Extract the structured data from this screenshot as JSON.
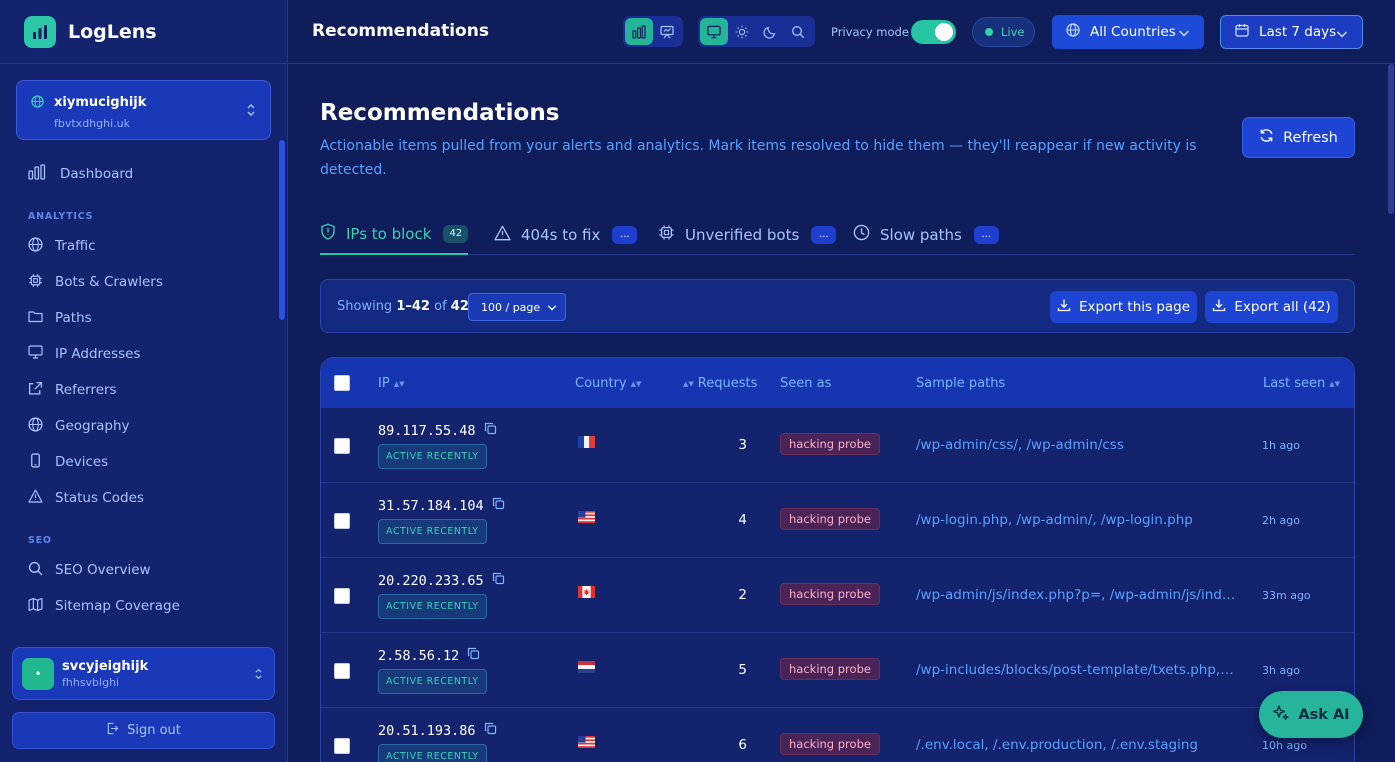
{
  "app": {
    "name": "LogLens"
  },
  "site": {
    "name": "xiymucighijk",
    "domain": "fbvtxdhghi.uk"
  },
  "nav": {
    "dashboard": "Dashboard",
    "sections": [
      {
        "title": "ANALYTICS",
        "items": [
          "Traffic",
          "Bots & Crawlers",
          "Paths",
          "IP Addresses",
          "Referrers",
          "Geography",
          "Devices",
          "Status Codes"
        ]
      },
      {
        "title": "SEO",
        "items": [
          "SEO Overview",
          "Sitemap Coverage"
        ]
      }
    ]
  },
  "user": {
    "initial": "•",
    "name": "svcyjeighijk",
    "sub": "fhhsvblghi"
  },
  "signout": "Sign out",
  "header": {
    "title": "Recommendations",
    "privacy_label": "Privacy mode",
    "live_label": "Live",
    "country": "All Countries",
    "date_range": "Last 7 days"
  },
  "page": {
    "title": "Recommendations",
    "description": "Actionable items pulled from your alerts and analytics. Mark items resolved to hide them — they'll reappear if new activity is detected.",
    "refresh": "Refresh"
  },
  "tabs": [
    {
      "label": "IPs to block",
      "badge": "42"
    },
    {
      "label": "404s to fix",
      "badge": "..."
    },
    {
      "label": "Unverified bots",
      "badge": "..."
    },
    {
      "label": "Slow paths",
      "badge": "..."
    }
  ],
  "toolbar": {
    "showing_prefix": "Showing",
    "range": "1–42",
    "of": "of",
    "total": "42",
    "per_page": "100 / page",
    "export_page": "Export this page",
    "export_all": "Export all (42)"
  },
  "table": {
    "columns": {
      "ip": "IP",
      "country": "Country",
      "requests": "Requests",
      "seen_as": "Seen as",
      "sample_paths": "Sample paths",
      "last_seen": "Last seen"
    },
    "rows": [
      {
        "ip": "89.117.55.48",
        "status": "ACTIVE RECENTLY",
        "country": "FR",
        "requests": "3",
        "seen_as": "hacking probe",
        "paths": "/wp-admin/css/, /wp-admin/css",
        "last_seen": "1h ago"
      },
      {
        "ip": "31.57.184.104",
        "status": "ACTIVE RECENTLY",
        "country": "US",
        "requests": "4",
        "seen_as": "hacking probe",
        "paths": "/wp-login.php, /wp-admin/, /wp-login.php",
        "last_seen": "2h ago"
      },
      {
        "ip": "20.220.233.65",
        "status": "ACTIVE RECENTLY",
        "country": "CA",
        "requests": "2",
        "seen_as": "hacking probe",
        "paths": "/wp-admin/js/index.php?p=, /wp-admin/js/index.php",
        "last_seen": "33m ago"
      },
      {
        "ip": "2.58.56.12",
        "status": "ACTIVE RECENTLY",
        "country": "NL",
        "requests": "5",
        "seen_as": "hacking probe",
        "paths": "/wp-includes/blocks/post-template/txets.php, /wp-includes",
        "last_seen": "3h ago"
      },
      {
        "ip": "20.51.193.86",
        "status": "ACTIVE RECENTLY",
        "country": "US",
        "requests": "6",
        "seen_as": "hacking probe",
        "paths": "/.env.local, /.env.production, /.env.staging",
        "last_seen": "10h ago"
      }
    ]
  },
  "ask_ai": "Ask AI",
  "colors": {
    "accent": "#2cc7a6",
    "primary": "#1d44d2",
    "background": "#0f1d5a",
    "link": "#5aa0ff",
    "probe_badge": "#4a2457"
  }
}
